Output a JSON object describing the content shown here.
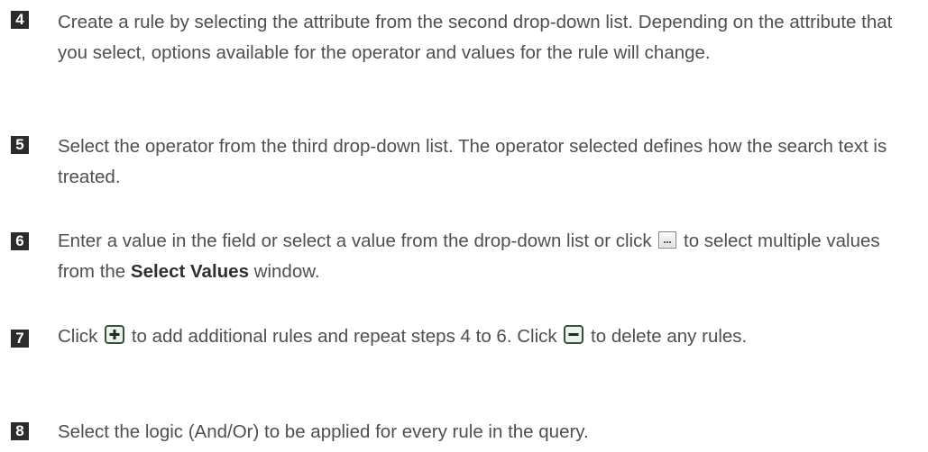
{
  "steps": [
    {
      "number": "4",
      "text": "Create a rule by selecting the attribute from the second drop-down list. Depending on the attribute that you select, options available for the operator and values for the rule will change."
    },
    {
      "number": "5",
      "text": "Select the operator from the third drop-down list. The operator selected defines how the search text is treated."
    },
    {
      "number": "6",
      "text_before_icon": "Enter a value in the field or select a value from the drop-down list or click",
      "icon": "ellipsis-button-icon",
      "text_after_icon": "to select multiple values from the",
      "strong": "Select Values",
      "text_end": "window."
    },
    {
      "number": "7",
      "text_start": "Click",
      "icon_add": "add-rule-icon",
      "text_middle": "to add additional rules and repeat steps 4 to 6. Click",
      "icon_remove": "remove-rule-icon",
      "text_end": "to delete any rules."
    },
    {
      "number": "8",
      "text": "Select the logic (And/Or) to be applied for every rule in the query."
    }
  ]
}
